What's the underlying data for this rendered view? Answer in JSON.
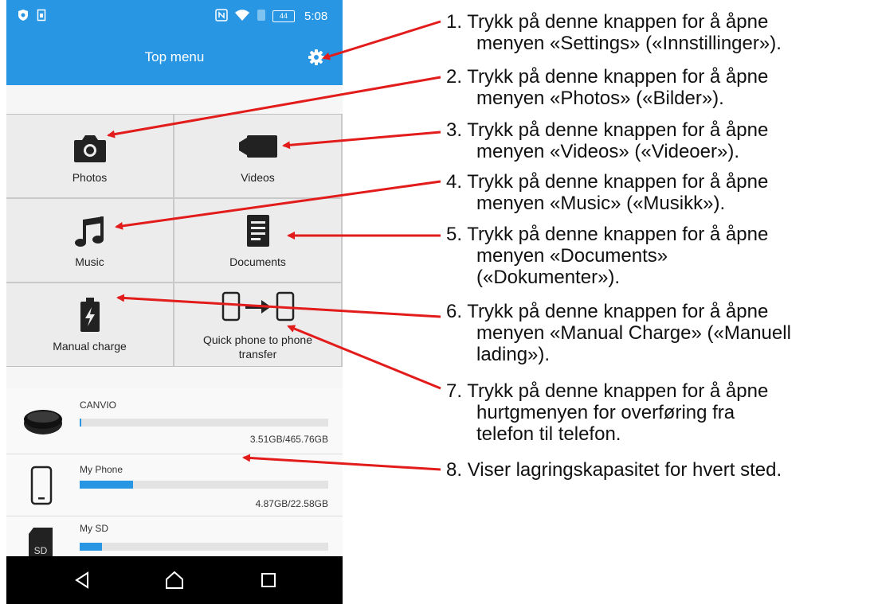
{
  "status_bar": {
    "battery": "44",
    "time": "5:08"
  },
  "app_bar": {
    "title": "Top menu"
  },
  "tiles": {
    "photos": "Photos",
    "videos": "Videos",
    "music": "Music",
    "documents": "Documents",
    "manual_charge": "Manual charge",
    "transfer_line1": "Quick phone to phone",
    "transfer_line2": "transfer"
  },
  "storage": [
    {
      "name": "CANVIO",
      "capacity": "3.51GB/465.76GB",
      "used_fraction": 0.0075
    },
    {
      "name": "My Phone",
      "capacity": "4.87GB/22.58GB",
      "used_fraction": 0.216
    },
    {
      "name": "My SD",
      "sd_label": "SD",
      "used_fraction": 0.09
    }
  ],
  "notes": [
    {
      "num": "1.",
      "line1": "Trykk på denne knappen for å åpne",
      "line2": "menyen «Settings» («Innstillinger»)."
    },
    {
      "num": "2.",
      "line1": "Trykk på denne knappen for å åpne",
      "line2": "menyen «Photos» («Bilder»)."
    },
    {
      "num": "3.",
      "line1": "Trykk på denne knappen for å åpne",
      "line2": "menyen «Videos» («Videoer»)."
    },
    {
      "num": "4.",
      "line1": "Trykk på denne knappen for å åpne",
      "line2": "menyen «Music» («Musikk»)."
    },
    {
      "num": "5.",
      "line1": "Trykk på denne knappen for å åpne",
      "line2": "menyen «Documents»",
      "line3": "(«Dokumenter»)."
    },
    {
      "num": "6.",
      "line1": "Trykk på denne knappen for å åpne",
      "line2": "menyen «Manual Charge» («Manuell",
      "line3": "lading»)."
    },
    {
      "num": "7.",
      "line1": "Trykk på denne knappen for å åpne",
      "line2": "hurtgmenyen for overføring fra",
      "line3": "telefon til telefon."
    },
    {
      "num": "8.",
      "line1": "Viser lagringskapasitet for hvert sted."
    }
  ],
  "colors": {
    "accent": "#2896e2",
    "arrow": "#e21b1b"
  },
  "icons": [
    "shield-icon",
    "sim-icon",
    "nfc-icon",
    "wifi-icon",
    "bluetooth-icon",
    "battery-icon",
    "gear-icon",
    "camera-icon",
    "video-camera-icon",
    "music-note-icon",
    "document-icon",
    "battery-charge-icon",
    "phone-transfer-icon",
    "hard-drive-icon",
    "phone-icon",
    "sd-card-icon",
    "back-icon",
    "home-icon",
    "recents-icon"
  ]
}
